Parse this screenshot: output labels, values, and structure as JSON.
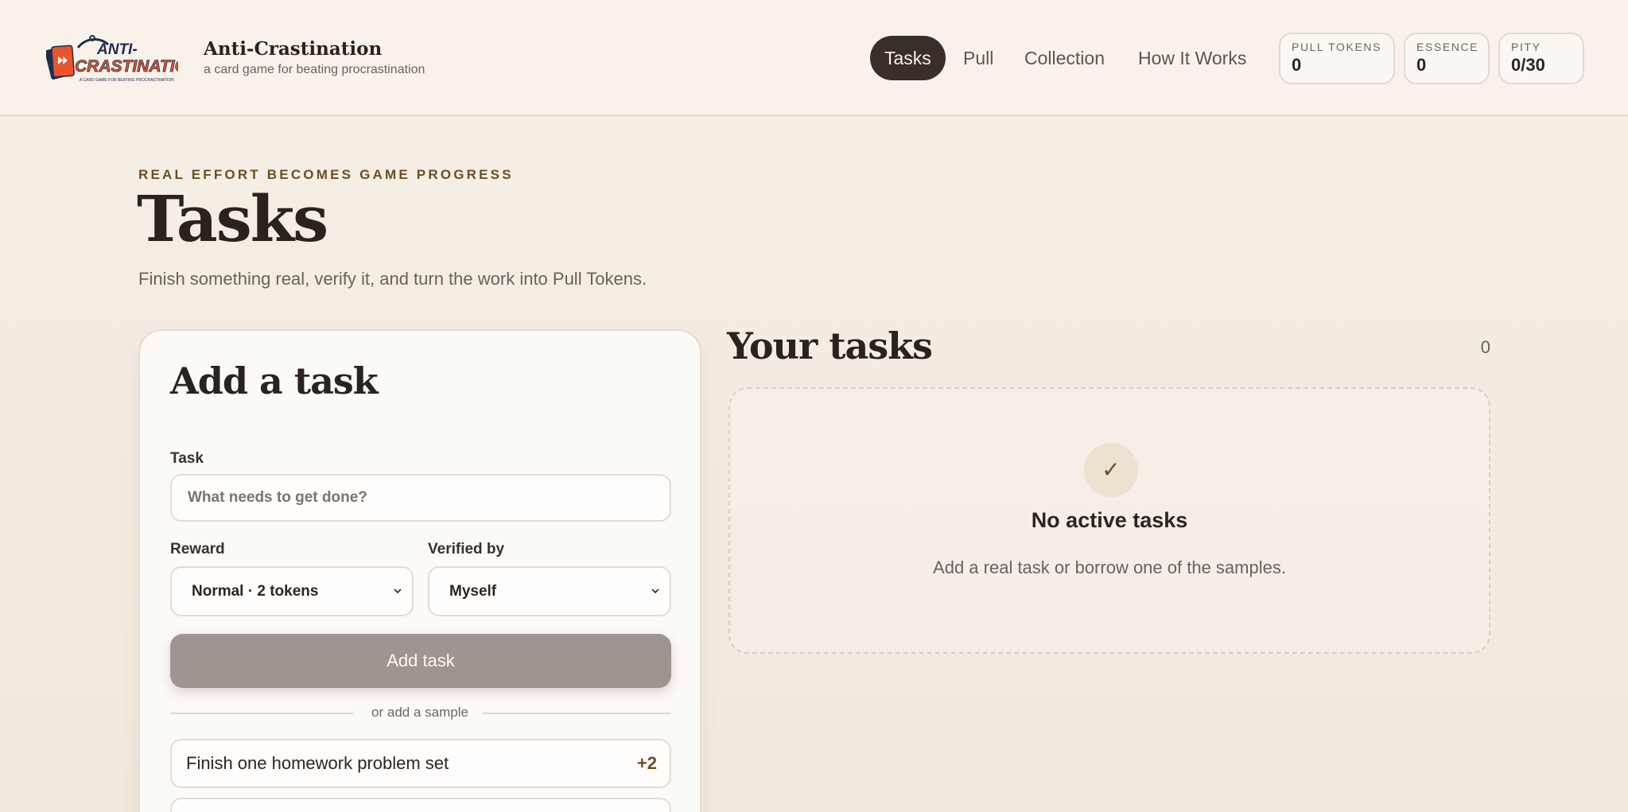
{
  "brand": {
    "logo_text_top": "ANTI-",
    "logo_text_main": "CRASTINATION",
    "logo_tagline": "A CARD GAME FOR BEATING PROCRASTINATION",
    "title": "Anti-Crastination",
    "subtitle": "a card game for beating procrastination"
  },
  "nav": {
    "items": [
      {
        "label": "Tasks",
        "active": true
      },
      {
        "label": "Pull",
        "active": false
      },
      {
        "label": "Collection",
        "active": false
      },
      {
        "label": "How It Works",
        "active": false
      }
    ]
  },
  "stats": [
    {
      "label": "PULL TOKENS",
      "value": "0"
    },
    {
      "label": "ESSENCE",
      "value": "0"
    },
    {
      "label": "PITY",
      "value": "0/30"
    }
  ],
  "hero": {
    "eyebrow": "REAL EFFORT BECOMES GAME PROGRESS",
    "title": "Tasks",
    "description": "Finish something real, verify it, and turn the work into Pull Tokens."
  },
  "add_task": {
    "title": "Add a task",
    "task_label": "Task",
    "task_placeholder": "What needs to get done?",
    "task_value": "",
    "reward_label": "Reward",
    "reward_value": "Normal · 2 tokens",
    "verified_label": "Verified by",
    "verified_value": "Myself",
    "add_button": "Add task",
    "divider": "or add a sample",
    "samples": [
      {
        "label": "Finish one homework problem set",
        "reward": "+2"
      }
    ]
  },
  "your_tasks": {
    "title": "Your tasks",
    "count": "0",
    "empty_icon": "✓",
    "empty_title": "No active tasks",
    "empty_desc": "Add a real task or borrow one of the samples."
  },
  "colors": {
    "accent_dark": "#3a2e28",
    "brand_orange": "#e8552b",
    "brand_navy": "#1f2d4d",
    "gold_text": "#6e4d23",
    "button_disabled": "#9e9590"
  }
}
